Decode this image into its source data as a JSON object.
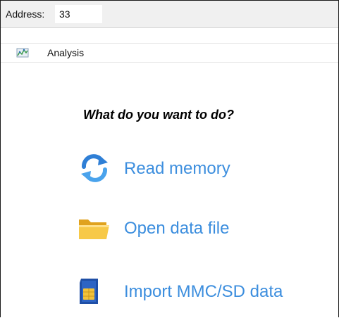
{
  "address_bar": {
    "label": "Address:",
    "value": "33"
  },
  "tab": {
    "icon": "analysis-icon",
    "label": "Analysis"
  },
  "main": {
    "question": "What do you want to do?",
    "actions": [
      {
        "icon": "refresh-icon",
        "label": "Read memory"
      },
      {
        "icon": "folder-icon",
        "label": "Open data file"
      },
      {
        "icon": "sd-card-icon",
        "label": "Import MMC/SD data"
      }
    ],
    "link_color": "#3c8ede"
  }
}
